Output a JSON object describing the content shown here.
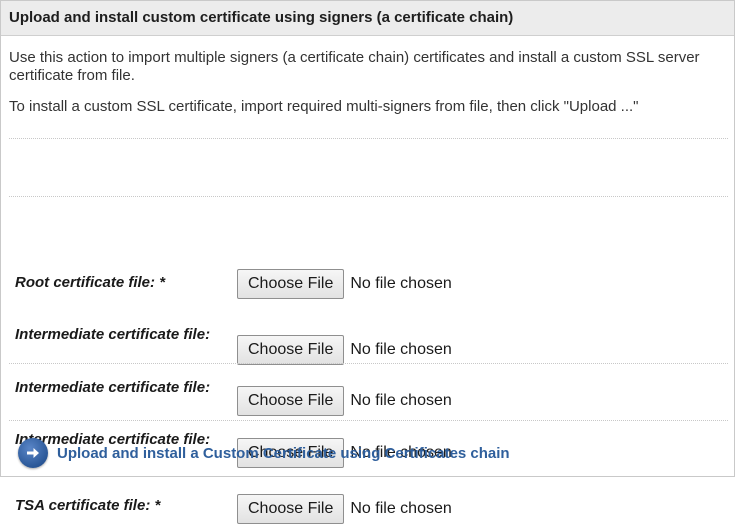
{
  "panel": {
    "title": "Upload and install custom certificate using signers (a certificate chain)",
    "description_1": "Use this action to import multiple signers (a certificate chain) certificates and install a custom SSL server certificate from file.",
    "description_2": "To install a custom SSL certificate, import required multi-signers from file, then click \"Upload ...\""
  },
  "fields": [
    {
      "label": "Root certificate file: *",
      "button": "Choose File",
      "status": "No file chosen"
    },
    {
      "label": "Intermediate certificate file:",
      "button": "Choose File",
      "status": "No file chosen"
    },
    {
      "label": "Intermediate certificate file:",
      "button": "Choose File",
      "status": "No file chosen"
    },
    {
      "label": "Intermediate certificate file:",
      "button": "Choose File",
      "status": "No file chosen"
    },
    {
      "label": "TSA certificate file: *",
      "button": "Choose File",
      "status": "No file chosen"
    }
  ],
  "action": {
    "label": "Upload and install a Custom Certificate using Certificates chain",
    "icon": "arrow-right-circle-icon"
  }
}
